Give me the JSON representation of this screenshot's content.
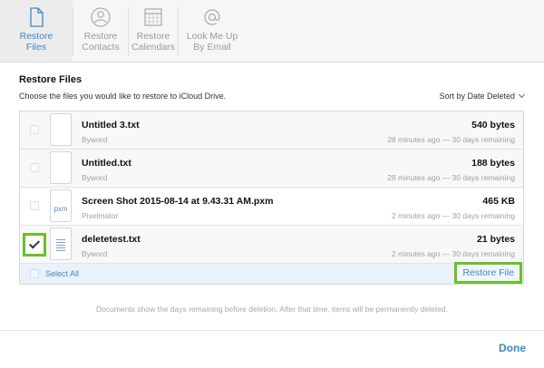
{
  "tabs": [
    {
      "line1": "Restore",
      "line2": "Files",
      "icon": "document-icon",
      "active": true
    },
    {
      "line1": "Restore",
      "line2": "Contacts",
      "icon": "contact-icon",
      "active": false
    },
    {
      "line1": "Restore",
      "line2": "Calendars",
      "icon": "calendar-icon",
      "active": false
    },
    {
      "line1": "Look Me Up",
      "line2": "By Email",
      "icon": "at-sign-icon",
      "active": false
    }
  ],
  "panel": {
    "title": "Restore Files",
    "description": "Choose the files you would like to restore to iCloud Drive.",
    "sort_label": "Sort by Date Deleted"
  },
  "files": [
    {
      "name": "Untitled 3.txt",
      "app": "Byword",
      "size": "540 bytes",
      "time": "28 minutes ago — 30 days remaining",
      "checked": false
    },
    {
      "name": "Untitled.txt",
      "app": "Byword",
      "size": "188 bytes",
      "time": "28 minutes ago — 30 days remaining",
      "checked": false
    },
    {
      "name": "Screen Shot 2015-08-14 at 9.43.31 AM.pxm",
      "app": "Pixelmator",
      "size": "465 KB",
      "time": "2 minutes ago — 30 days remaining",
      "checked": false,
      "ext": "pxm"
    },
    {
      "name": "deletetest.txt",
      "app": "Byword",
      "size": "21 bytes",
      "time": "2 minutes ago — 30 days remaining",
      "checked": true
    }
  ],
  "footer": {
    "select_all": "Select All",
    "restore_button": "Restore File"
  },
  "note": "Documents show the days remaining before deletion. After that time, items will be permanently deleted.",
  "done_label": "Done",
  "colors": {
    "accent": "#3f86c8",
    "highlight": "#6ac02a"
  }
}
